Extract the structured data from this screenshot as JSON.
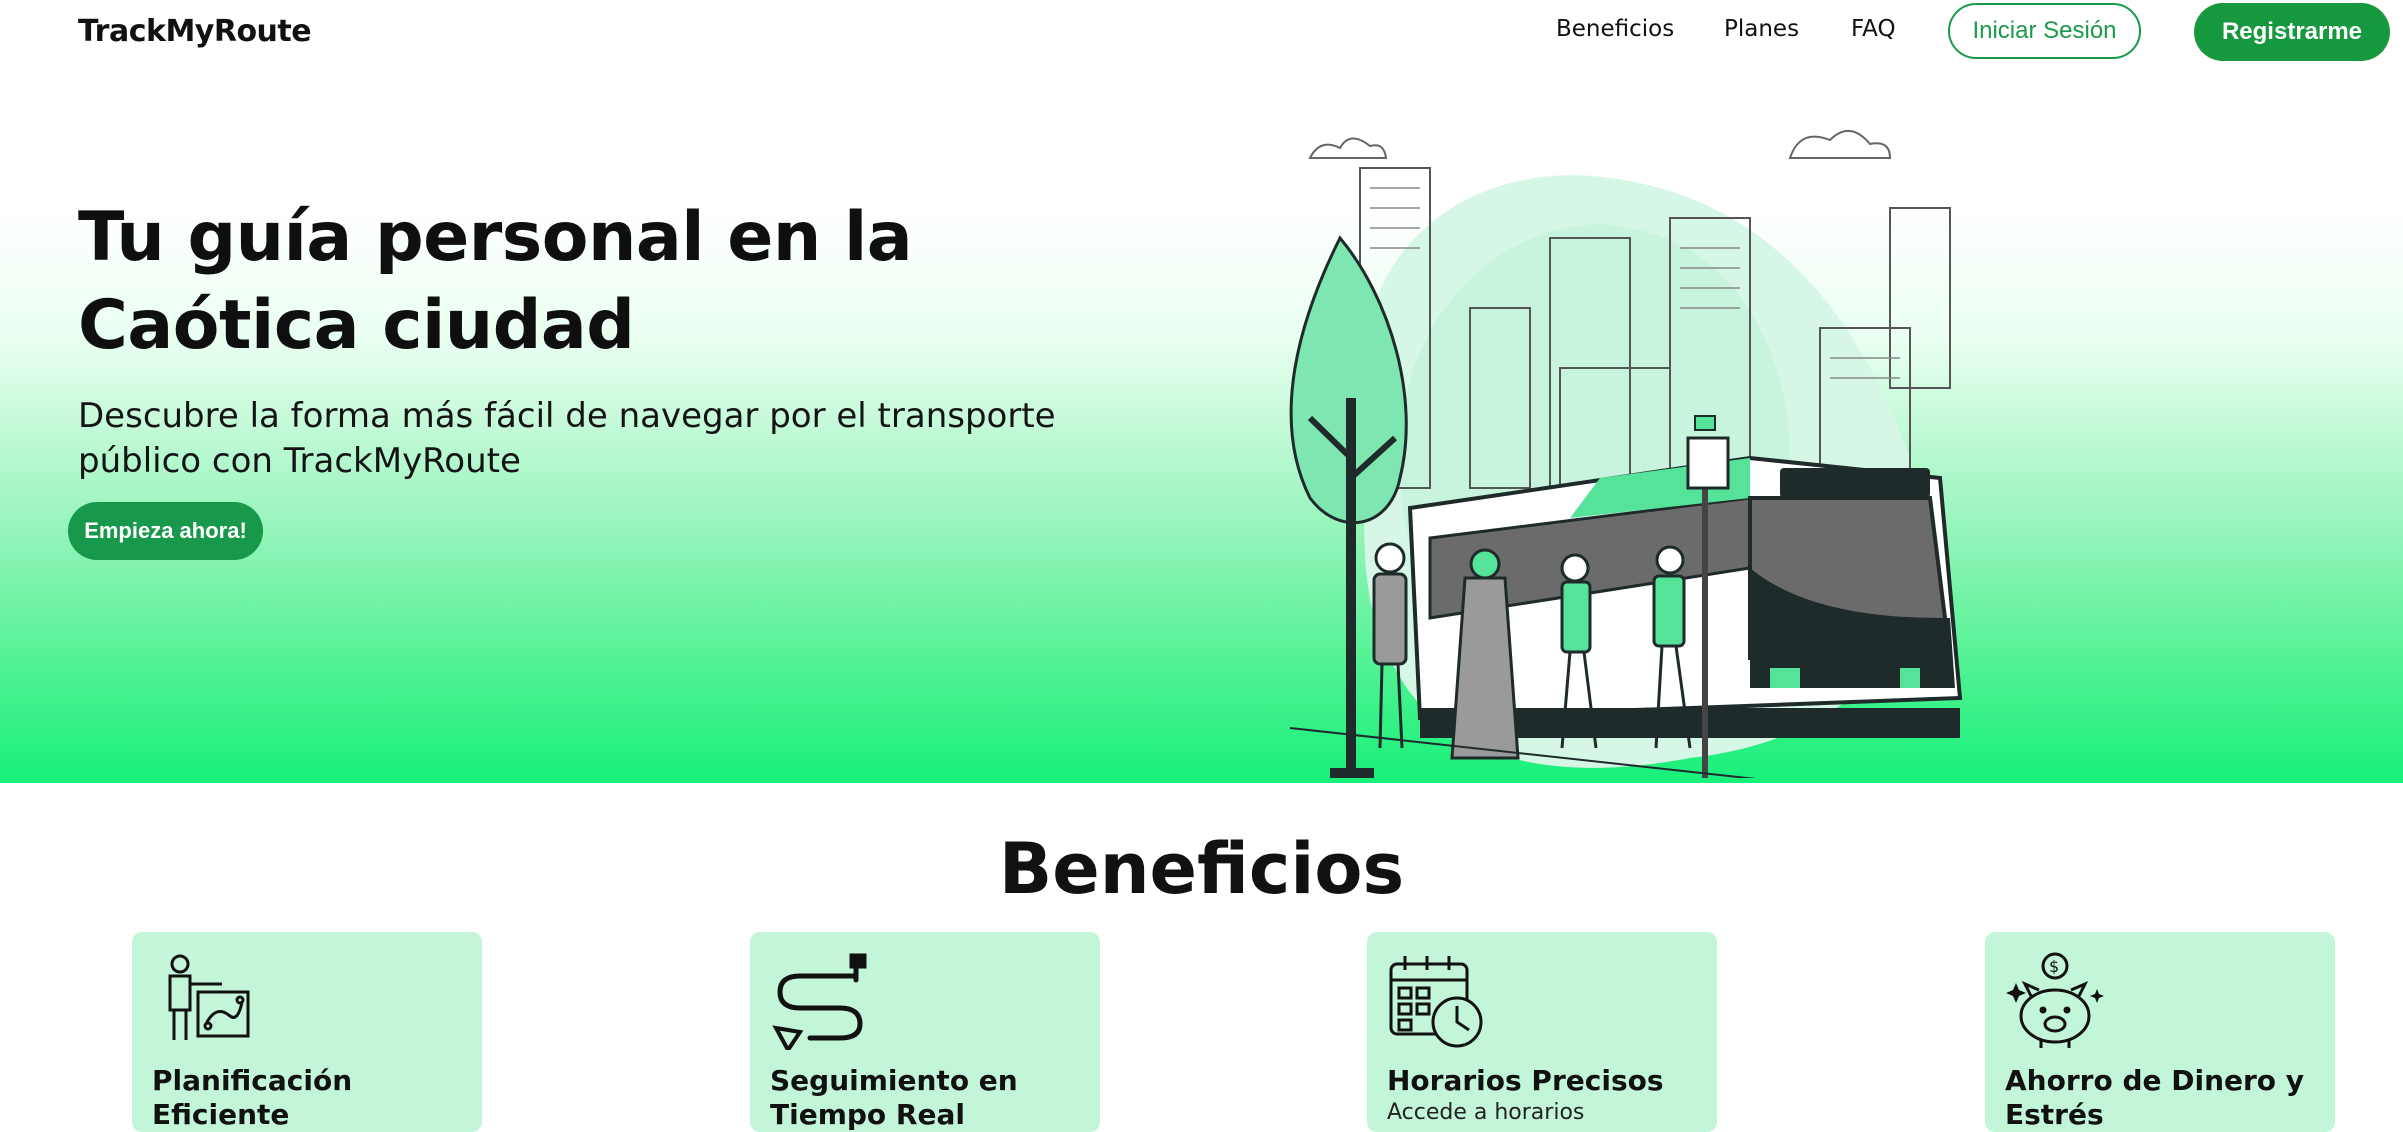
{
  "nav": {
    "logo": "TrackMyRoute",
    "links": [
      "Beneficios",
      "Planes",
      "FAQ"
    ],
    "login": "Iniciar Sesión",
    "register": "Registrarme"
  },
  "hero": {
    "title": "Tu guía personal en la Caótica ciudad",
    "subtitle": "Descubre la forma más fácil de navegar por el transporte público con TrackMyRoute",
    "cta": "Empieza ahora!"
  },
  "benefits": {
    "title": "Beneficios",
    "cards": [
      {
        "title": "Planificación Eficiente",
        "icon": "planning-icon"
      },
      {
        "title": "Seguimiento en Tiempo Real",
        "icon": "route-tracking-icon"
      },
      {
        "title": "Horarios Precisos",
        "desc": "Accede a horarios",
        "icon": "calendar-clock-icon"
      },
      {
        "title": "Ahorro de Dinero y Estrés",
        "icon": "piggy-bank-icon"
      }
    ]
  },
  "colors": {
    "brand_green": "#16983f",
    "card_bg": "#c3f5d8",
    "hero_gradient_end": "#17f07a",
    "illustration_accent": "#55e39a"
  }
}
